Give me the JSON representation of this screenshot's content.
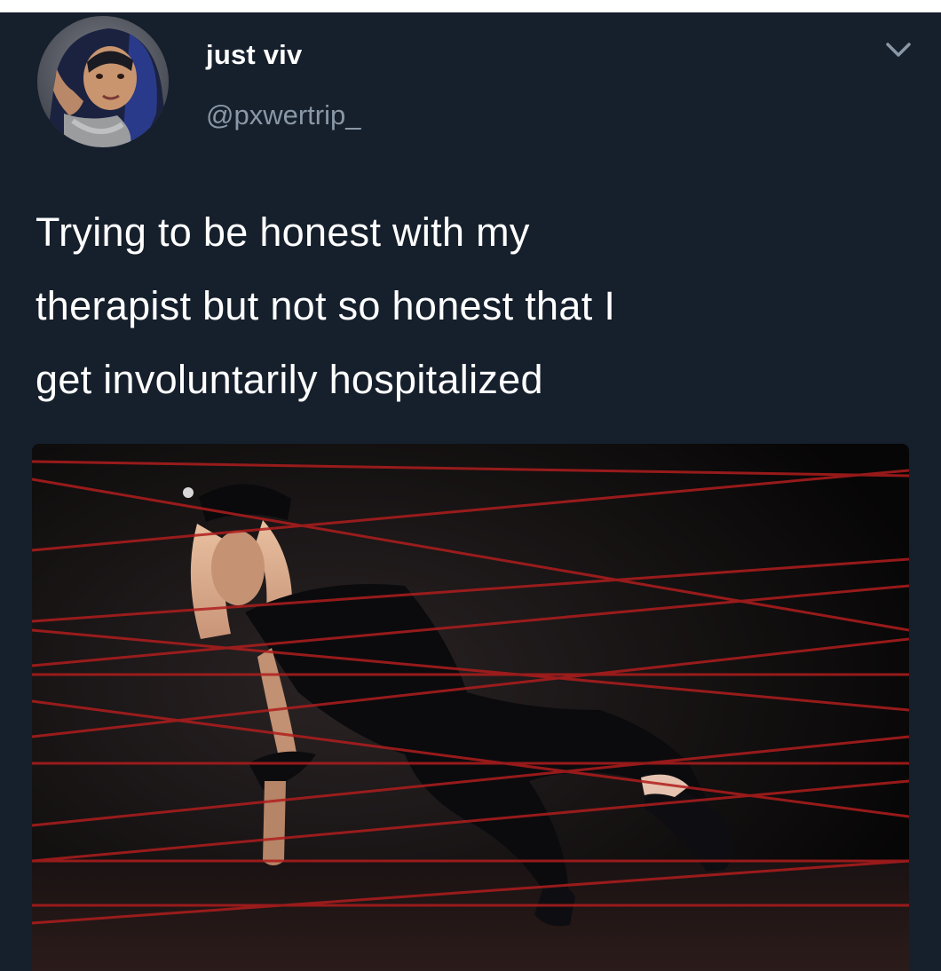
{
  "tweet": {
    "display_name": "just viv",
    "handle": "@pxwertrip_",
    "text_lines": [
      "Trying to be honest with my",
      "therapist but not so honest that I",
      "get involuntarily hospitalized"
    ],
    "menu_icon": "chevron-down-icon",
    "avatar_icon": "avatar-photo",
    "media_description_icon": "laser-maze-photo"
  },
  "colors": {
    "tweet_background": "#16202c",
    "name_text": "#ffffff",
    "handle_text": "#8a97a6",
    "laser": "#b01d1d"
  }
}
